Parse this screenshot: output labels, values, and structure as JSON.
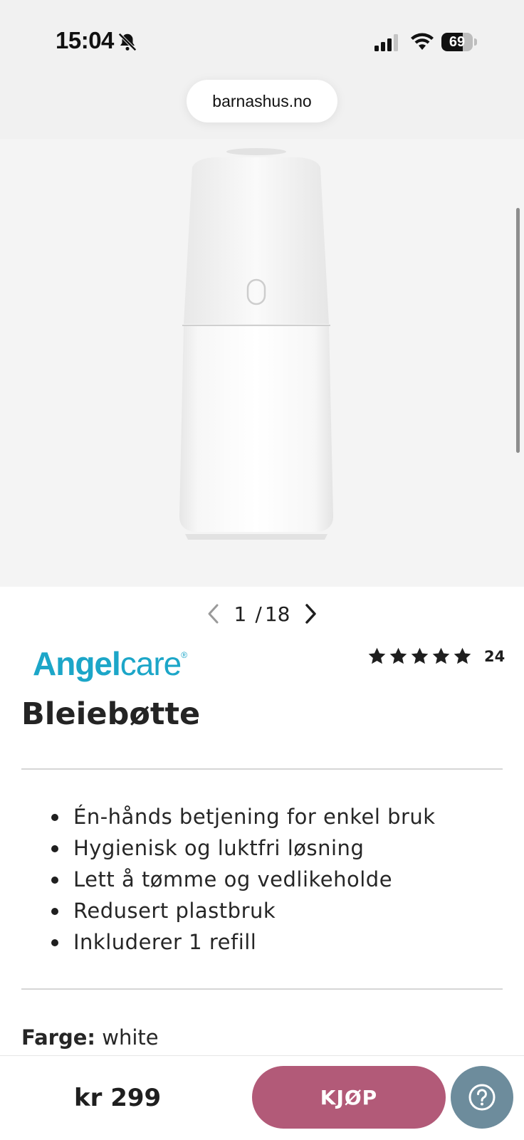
{
  "status_bar": {
    "time": "15:04",
    "battery_level": "69",
    "icons": [
      "bell-off-icon",
      "signal-icon",
      "wifi-icon",
      "battery-icon"
    ]
  },
  "browser": {
    "url": "barnashus.no"
  },
  "gallery": {
    "current": "1",
    "separator": "/",
    "total": "18"
  },
  "product": {
    "brand_part1": "Angel",
    "brand_part2": "care",
    "brand_mark": "®",
    "brand_color": "#1ca6c8",
    "rating_stars": 5,
    "rating_count": "24",
    "title": "Bleiebøtte",
    "features": [
      "Én-hånds betjening for enkel bruk",
      "Hygienisk og luktfri løsning",
      "Lett å tømme og vedlikeholde",
      "Redusert plastbruk",
      "Inkluderer 1 refill"
    ],
    "color_label": "Farge:",
    "color_value": "white"
  },
  "purchase": {
    "price": "kr 299",
    "buy_label": "KJØP",
    "buy_color": "#b25a78",
    "help_color": "#6d8c9c"
  }
}
